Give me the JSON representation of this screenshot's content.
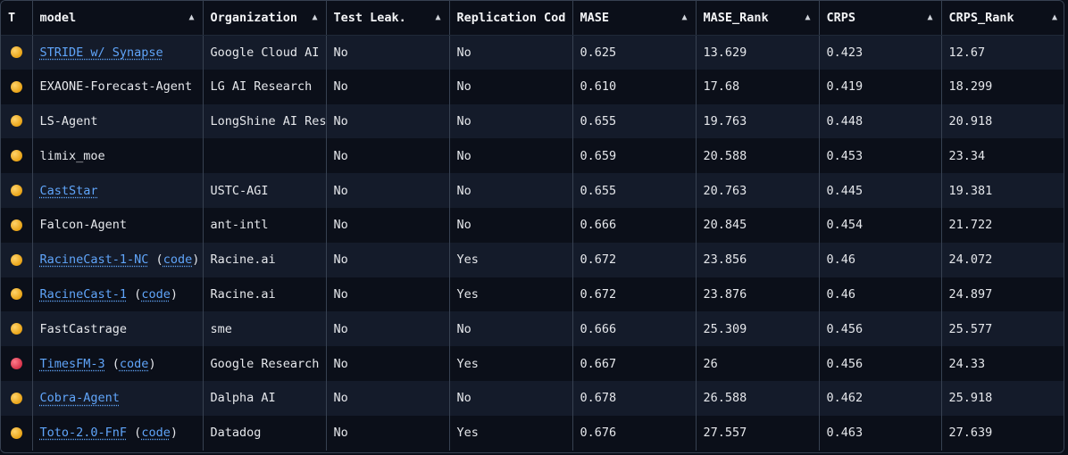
{
  "table": {
    "columns": [
      {
        "label": "T"
      },
      {
        "label": "model"
      },
      {
        "label": "Organization"
      },
      {
        "label": "Test Leak."
      },
      {
        "label": "Replication Code"
      },
      {
        "label": "MASE"
      },
      {
        "label": "MASE_Rank"
      },
      {
        "label": "CRPS"
      },
      {
        "label": "CRPS_Rank"
      }
    ],
    "sort_glyph": "▲",
    "code_link_text": "code",
    "rows": [
      {
        "type_color": "#f5b83d",
        "model": "STRIDE w/ Synapse",
        "model_link": true,
        "has_code": false,
        "org": "Google Cloud AI",
        "leak": "No",
        "repl": "No",
        "mase": "0.625",
        "mase_rank": "13.629",
        "crps": "0.423",
        "crps_rank": "12.67"
      },
      {
        "type_color": "#f5b83d",
        "model": "EXAONE-Forecast-Agent",
        "model_link": false,
        "has_code": false,
        "org": "LG AI Research",
        "leak": "No",
        "repl": "No",
        "mase": "0.610",
        "mase_rank": "17.68",
        "crps": "0.419",
        "crps_rank": "18.299"
      },
      {
        "type_color": "#f5b83d",
        "model": "LS-Agent",
        "model_link": false,
        "has_code": false,
        "org": "LongShine AI Research",
        "leak": "No",
        "repl": "No",
        "mase": "0.655",
        "mase_rank": "19.763",
        "crps": "0.448",
        "crps_rank": "20.918"
      },
      {
        "type_color": "#f5b83d",
        "model": "limix_moe",
        "model_link": false,
        "has_code": false,
        "org": "",
        "leak": "No",
        "repl": "No",
        "mase": "0.659",
        "mase_rank": "20.588",
        "crps": "0.453",
        "crps_rank": "23.34"
      },
      {
        "type_color": "#f5b83d",
        "model": "CastStar",
        "model_link": true,
        "has_code": false,
        "org": "USTC-AGI",
        "leak": "No",
        "repl": "No",
        "mase": "0.655",
        "mase_rank": "20.763",
        "crps": "0.445",
        "crps_rank": "19.381"
      },
      {
        "type_color": "#f5b83d",
        "model": "Falcon-Agent",
        "model_link": false,
        "has_code": false,
        "org": "ant-intl",
        "leak": "No",
        "repl": "No",
        "mase": "0.666",
        "mase_rank": "20.845",
        "crps": "0.454",
        "crps_rank": "21.722"
      },
      {
        "type_color": "#f5b83d",
        "model": "RacineCast-1-NC",
        "model_link": true,
        "has_code": true,
        "org": "Racine.ai",
        "leak": "No",
        "repl": "Yes",
        "mase": "0.672",
        "mase_rank": "23.856",
        "crps": "0.46",
        "crps_rank": "24.072"
      },
      {
        "type_color": "#f5b83d",
        "model": "RacineCast-1",
        "model_link": true,
        "has_code": true,
        "org": "Racine.ai",
        "leak": "No",
        "repl": "Yes",
        "mase": "0.672",
        "mase_rank": "23.876",
        "crps": "0.46",
        "crps_rank": "24.897"
      },
      {
        "type_color": "#f5b83d",
        "model": "FastCastrage",
        "model_link": false,
        "has_code": false,
        "org": "sme",
        "leak": "No",
        "repl": "No",
        "mase": "0.666",
        "mase_rank": "25.309",
        "crps": "0.456",
        "crps_rank": "25.577"
      },
      {
        "type_color": "#e0465a",
        "model": "TimesFM-3",
        "model_link": true,
        "has_code": true,
        "org": "Google Research",
        "leak": "No",
        "repl": "Yes",
        "mase": "0.667",
        "mase_rank": "26",
        "crps": "0.456",
        "crps_rank": "24.33"
      },
      {
        "type_color": "#f5b83d",
        "model": "Cobra-Agent",
        "model_link": true,
        "has_code": false,
        "org": "Dalpha AI",
        "leak": "No",
        "repl": "No",
        "mase": "0.678",
        "mase_rank": "26.588",
        "crps": "0.462",
        "crps_rank": "25.918"
      },
      {
        "type_color": "#f5b83d",
        "model": "Toto-2.0-FnF",
        "model_link": true,
        "has_code": true,
        "org": "Datadog",
        "leak": "No",
        "repl": "Yes",
        "mase": "0.676",
        "mase_rank": "27.557",
        "crps": "0.463",
        "crps_rank": "27.639"
      }
    ]
  }
}
